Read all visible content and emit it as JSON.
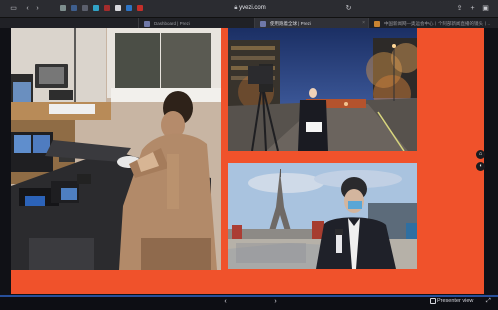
{
  "browser": {
    "address": "yvezi.com",
    "tabs": [
      {
        "label": "Dashboard | Prezi",
        "active": false
      },
      {
        "label": "使用跑着全球 | Prezi",
        "active": true
      },
      {
        "label": "中国新闻网—奥运会中心丨个阿部新闻直播的镜头丨..",
        "active": false
      }
    ]
  },
  "slide": {
    "background": "#f0522b",
    "photos": [
      {
        "subject": "studio-operator"
      },
      {
        "subject": "champs-elysees-reporter"
      },
      {
        "subject": "eiffel-tower-reporter"
      }
    ],
    "side_controls": [
      "home-icon",
      "zoom-icon"
    ]
  },
  "presentation": {
    "presenter_view_label": "Presenter view"
  }
}
